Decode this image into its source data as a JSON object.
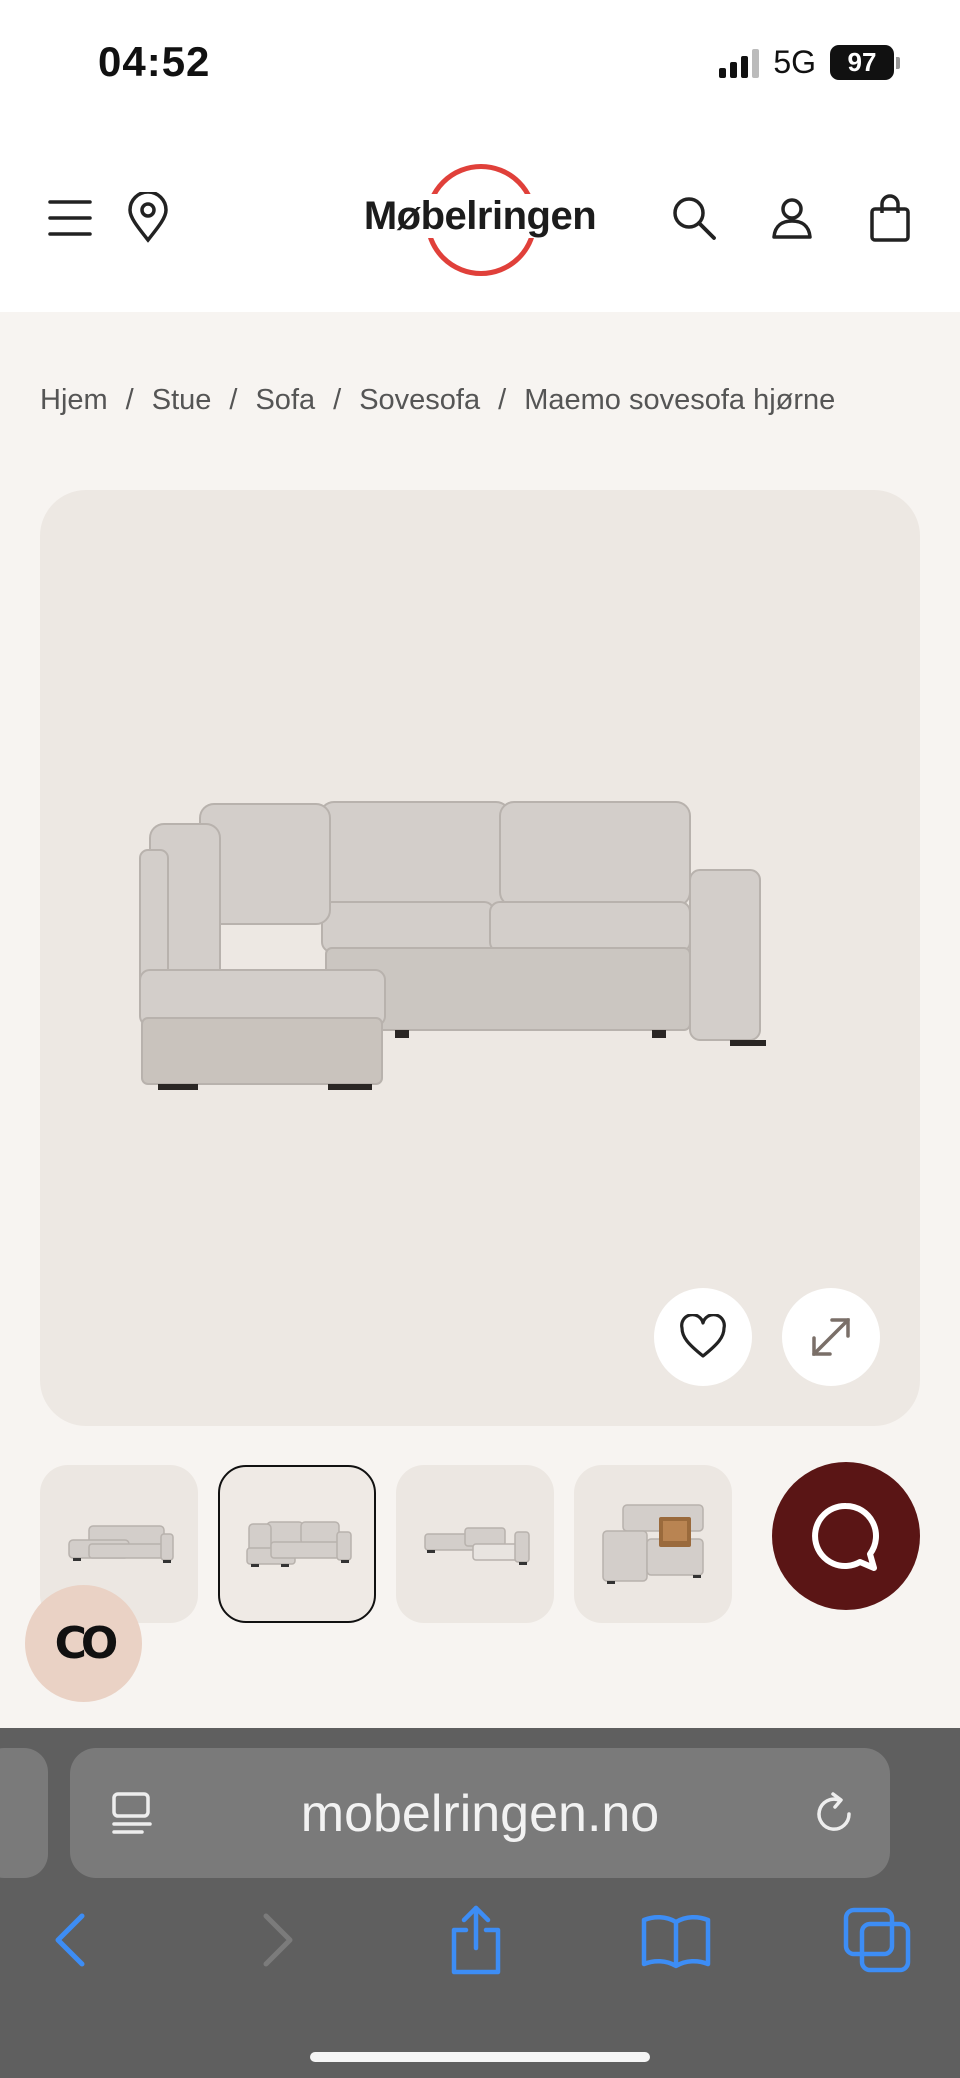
{
  "status": {
    "time": "04:52",
    "network": "5G",
    "battery": "97"
  },
  "header": {
    "logo_text": "Møbelringen",
    "icons": [
      "menu-icon",
      "location-pin-icon",
      "search-icon",
      "user-icon",
      "shopping-bag-icon"
    ],
    "brand_color": "#e0403a"
  },
  "breadcrumb": {
    "items": [
      "Hjem",
      "Stue",
      "Sofa",
      "Sovesofa",
      "Maemo sovesofa hjørne"
    ],
    "separator": "/"
  },
  "gallery": {
    "buttons": [
      "heart-icon",
      "expand-icon"
    ],
    "thumbnails": [
      {
        "label": "sofa-angle-view",
        "active": false
      },
      {
        "label": "sofa-front-view",
        "active": true
      },
      {
        "label": "sofa-bed-open-view",
        "active": false
      },
      {
        "label": "sofa-storage-view",
        "active": false
      }
    ]
  },
  "chat": {
    "icon": "chat-bubble-icon",
    "color": "#5a1515"
  },
  "co_widget": {
    "label": "CO"
  },
  "browser": {
    "url": "mobelringen.no",
    "toolbar": [
      "back-icon",
      "forward-icon",
      "share-icon",
      "bookmarks-icon",
      "tabs-icon"
    ],
    "accent": "#3d8df5"
  }
}
